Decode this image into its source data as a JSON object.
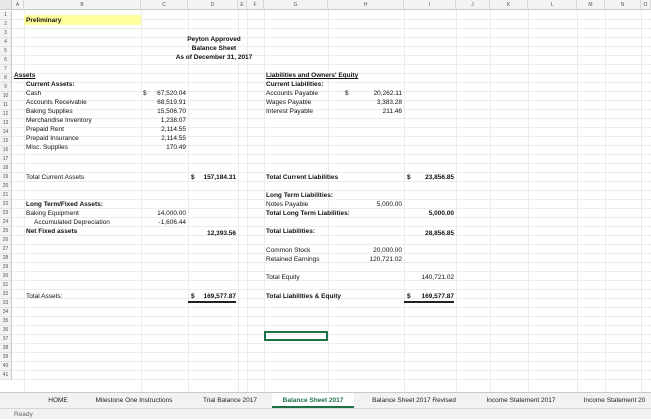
{
  "columns": [
    "A",
    "B",
    "C",
    "D",
    "E",
    "F",
    "G",
    "H",
    "I",
    "J",
    "K",
    "L",
    "M",
    "N",
    "O"
  ],
  "rows": [
    "1",
    "2",
    "3",
    "4",
    "5",
    "6",
    "7",
    "8",
    "9",
    "10",
    "11",
    "12",
    "13",
    "14",
    "15",
    "16",
    "17",
    "18",
    "19",
    "20",
    "21",
    "22",
    "23",
    "24",
    "25",
    "26",
    "27",
    "28",
    "29",
    "30",
    "31",
    "32",
    "33",
    "34",
    "35",
    "36",
    "37",
    "38",
    "39",
    "40",
    "41"
  ],
  "sheet": {
    "preliminary": "Preliminary",
    "company": "Peyton Approved",
    "title": "Balance Sheet",
    "date": "As of December 31, 2017",
    "assets_header": "Assets",
    "current_assets": "Current Assets:",
    "asset_items": [
      {
        "label": "Cash",
        "value": "67,520.04",
        "prefix": "$"
      },
      {
        "label": "Accounts Receivable",
        "value": "68,519.91"
      },
      {
        "label": "Baking Supplies",
        "value": "15,506.70"
      },
      {
        "label": "Merchandise Inventory",
        "value": "1,238.07"
      },
      {
        "label": "Prepaid Rent",
        "value": "2,114.55"
      },
      {
        "label": "Prepaid Insurance",
        "value": "2,114.55"
      },
      {
        "label": "Misc. Supplies",
        "value": "170.49"
      }
    ],
    "total_current_assets_label": "Total Current Assets",
    "total_current_assets_value": "157,184.31",
    "long_term_assets": "Long Term/Fixed Assets:",
    "baking_equipment_label": "Baking Equipment",
    "baking_equipment_value": "14,000.00",
    "acc_dep_label": "Accumulated Depreciation",
    "acc_dep_value": "-1,606.44",
    "net_fixed_label": "Net Fixed assets",
    "net_fixed_value": "12,393.56",
    "total_assets_label": "Total Assets:",
    "total_assets_value": "169,577.87",
    "liab_header": "Liabilities and Owners' Equity",
    "current_liab": "Current Liabilities:",
    "liab_items": [
      {
        "label": "Accounts Payable",
        "prefix": "$",
        "value": "20,262.11"
      },
      {
        "label": "Wages Payable",
        "value": "3,383.28"
      },
      {
        "label": "Interest Payable",
        "value": "211.46"
      }
    ],
    "total_current_liab_label": "Total Current Liabilities",
    "total_current_liab_value": "23,856.85",
    "long_term_liab": "Long Term Liabilities:",
    "notes_payable_label": "Notes Payable",
    "notes_payable_value": "5,000.00",
    "total_long_term_label": "Total Long Term Liabilities:",
    "total_long_term_value": "5,000.00",
    "total_liab_label": "Total Liabilities:",
    "total_liab_value": "28,856.85",
    "common_stock_label": "Common Stock",
    "common_stock_value": "20,000.00",
    "retained_label": "Retained Earnings",
    "retained_value": "120,721.02",
    "total_equity_label": "Total Equity",
    "total_equity_value": "140,721.02",
    "total_le_label": "Total Liabilities & Equity",
    "total_le_value": "169,577.87",
    "dollar": "$"
  },
  "tabs": [
    {
      "label": "HOME"
    },
    {
      "label": "Milestone One Instructions"
    },
    {
      "label": "Trial Balance 2017"
    },
    {
      "label": "Balance Sheet 2017"
    },
    {
      "label": "Balance Sheet 2017 Revised"
    },
    {
      "label": "Income Statement 2017"
    },
    {
      "label": "Income Statement 20"
    }
  ],
  "status": "Ready",
  "colors": {
    "accent": "#1e7145",
    "highlight": "#ffff9c"
  }
}
